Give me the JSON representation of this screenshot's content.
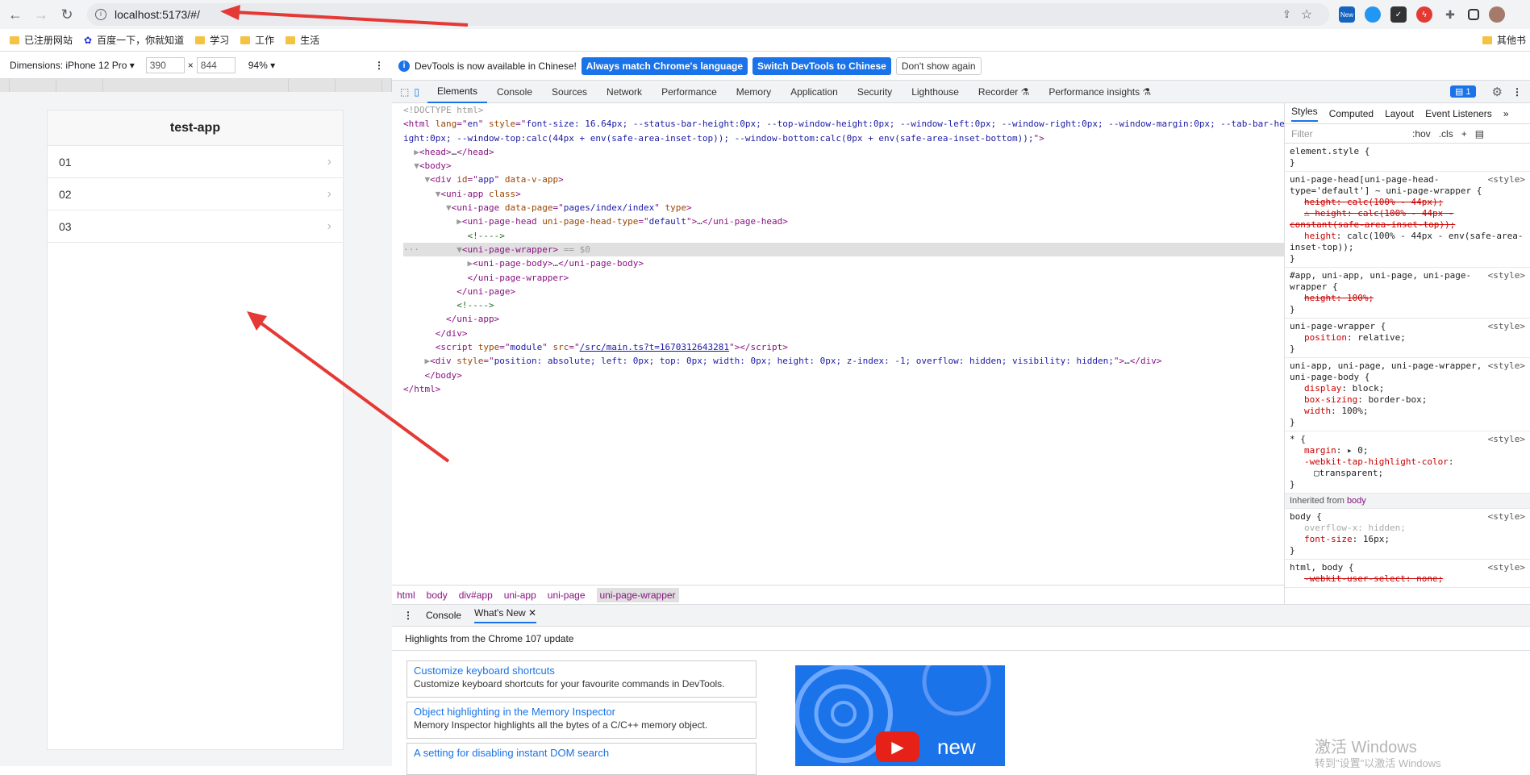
{
  "browser": {
    "url": "localhost:5173/#/",
    "bookmarks": [
      "已注册网站",
      "百度一下，你就知道",
      "学习",
      "工作",
      "生活"
    ],
    "other_bookmarks": "其他书"
  },
  "device_toolbar": {
    "dimensions_label": "Dimensions: iPhone 12 Pro ▾",
    "width": "390",
    "times": "×",
    "height": "844",
    "zoom": "94% ▾"
  },
  "app": {
    "title": "test-app",
    "items": [
      "01",
      "02",
      "03"
    ]
  },
  "infobar": {
    "text": "DevTools is now available in Chinese!",
    "btn_match": "Always match Chrome's language",
    "btn_switch": "Switch DevTools to Chinese",
    "btn_dismiss": "Don't show again"
  },
  "devtools_tabs": [
    "Elements",
    "Console",
    "Sources",
    "Network",
    "Performance",
    "Memory",
    "Application",
    "Security",
    "Lighthouse",
    "Recorder ⚗",
    "Performance insights ⚗"
  ],
  "issues_badge": "1",
  "styles_tabs": [
    "Styles",
    "Computed",
    "Layout",
    "Event Listeners",
    "»"
  ],
  "styles_filter": {
    "placeholder": "Filter",
    "hov": ":hov",
    "cls": ".cls"
  },
  "breadcrumbs": [
    "html",
    "body",
    "div#app",
    "uni-app",
    "uni-page",
    "uni-page-wrapper"
  ],
  "drawer": {
    "tabs": [
      "Console",
      "What's New ✕"
    ],
    "highlights": "Highlights from the Chrome 107 update",
    "cards": [
      {
        "title": "Customize keyboard shortcuts",
        "desc": "Customize keyboard shortcuts for your favourite commands in DevTools."
      },
      {
        "title": "Object highlighting in the Memory Inspector",
        "desc": "Memory Inspector highlights all the bytes of a C/C++ memory object."
      },
      {
        "title": "A setting for disabling instant DOM search",
        "desc": ""
      }
    ],
    "video_text": "new"
  },
  "watermark": {
    "line1": "激活 Windows",
    "line2": "转到\"设置\"以激活 Windows"
  },
  "styles": {
    "element_style": "element.style {",
    "inherited_label": "Inherited from",
    "inherited_from": "body"
  }
}
